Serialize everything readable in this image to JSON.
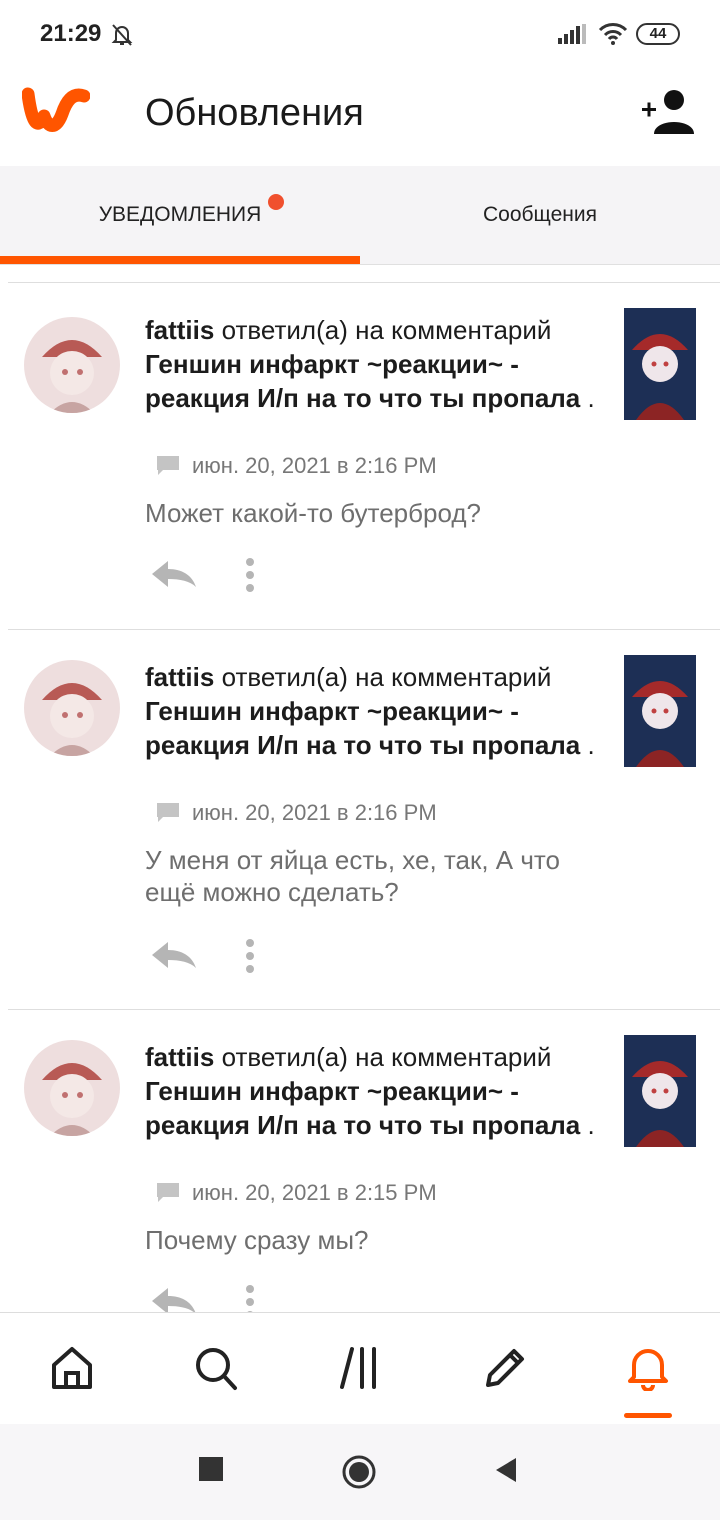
{
  "status_bar": {
    "time": "21:29",
    "battery": "44",
    "icons": [
      "bell-off-icon",
      "signal-icon",
      "wifi-icon",
      "battery-icon"
    ]
  },
  "app_bar": {
    "title": "Обновления",
    "logo": "wattpad-logo",
    "action_icon": "add-user-icon"
  },
  "tabs": [
    {
      "label": "УВЕДОМЛЕНИЯ",
      "active": true,
      "has_badge": true
    },
    {
      "label": "Сообщения",
      "active": false,
      "has_badge": false
    }
  ],
  "accent_color": "#ff5500",
  "badge_color": "#f0502e",
  "notifications": [
    {
      "user": "fattiis",
      "action": "ответил(а) на комментарий",
      "story": "Геншин инфаркт ~реакции~ - реакция И/п на то что ты пропала",
      "trailing": ".",
      "timestamp": "июн. 20, 2021 в 2:16 PM",
      "comment": "Может какой-то бутерброд?"
    },
    {
      "user": "fattiis",
      "action": "ответил(а) на комментарий",
      "story": "Геншин инфаркт ~реакции~ - реакция И/п на то что ты пропала",
      "trailing": ".",
      "timestamp": "июн. 20, 2021 в 2:16 PM",
      "comment": "У меня от яйца есть, хе, так, А что ещё можно сделать?"
    },
    {
      "user": "fattiis",
      "action": "ответил(а) на комментарий",
      "story": "Геншин инфаркт ~реакции~ - реакция И/п на то что ты пропала",
      "trailing": ".",
      "timestamp": "июн. 20, 2021 в 2:15 PM",
      "comment": "Почему сразу мы?"
    }
  ],
  "bottom_nav": [
    {
      "icon": "home-icon",
      "active": false
    },
    {
      "icon": "search-icon",
      "active": false
    },
    {
      "icon": "library-icon",
      "active": false
    },
    {
      "icon": "pencil-icon",
      "active": false
    },
    {
      "icon": "bell-icon",
      "active": true
    }
  ],
  "system_nav": [
    "recents-icon",
    "home-circle-icon",
    "back-icon"
  ]
}
